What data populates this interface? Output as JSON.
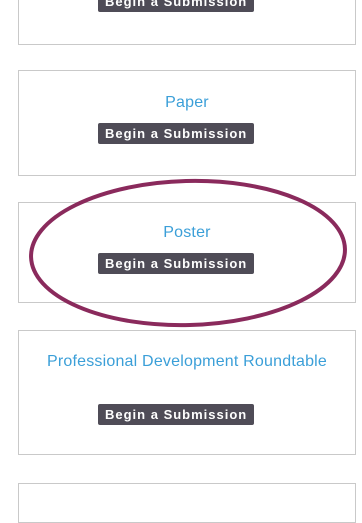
{
  "cards": [
    {
      "title": "",
      "button_label": "Begin a Submission"
    },
    {
      "title": "Paper",
      "button_label": "Begin a Submission"
    },
    {
      "title": "Poster",
      "button_label": "Begin a Submission"
    },
    {
      "title": "Professional Development Roundtable",
      "button_label": "Begin a Submission"
    },
    {
      "title": "",
      "button_label": ""
    }
  ],
  "colors": {
    "title": "#3b9fd8",
    "button_bg": "#4f4c57",
    "button_text": "#ffffff",
    "card_border": "#c9c9c9",
    "highlight_ellipse": "#8a2a5c"
  }
}
